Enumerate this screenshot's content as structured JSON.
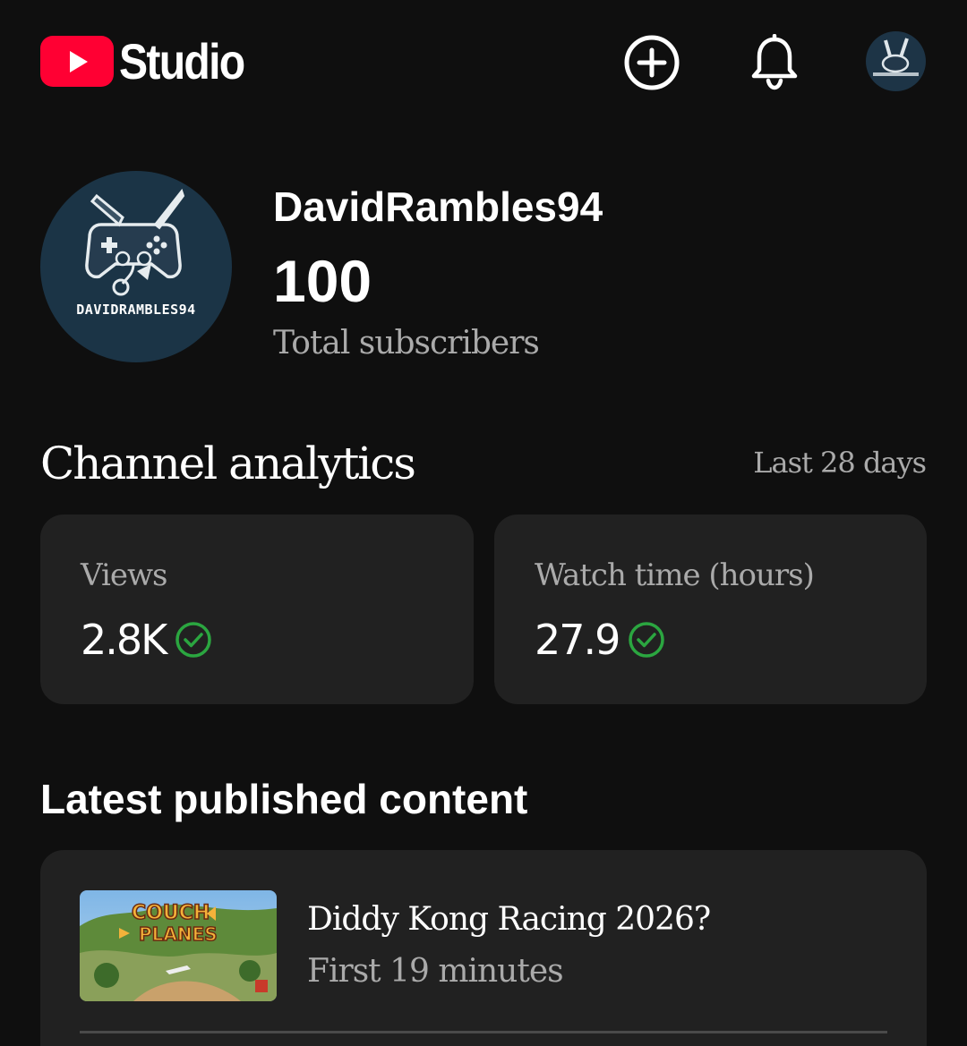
{
  "header": {
    "app_name": "Studio",
    "colors": {
      "brand": "#ff0033",
      "background": "#0f0f0f"
    },
    "icons": [
      "youtube-logo-icon",
      "create-plus-icon",
      "bell-icon",
      "account-avatar"
    ]
  },
  "channel": {
    "name": "DavidRambles94",
    "avatar_text": "DAVIDRAMBLES94",
    "subscriber_count": "100",
    "subscriber_label": "Total subscribers"
  },
  "analytics": {
    "title": "Channel analytics",
    "period": "Last 28 days",
    "cards": [
      {
        "label": "Views",
        "value": "2.8K",
        "status_icon": "check-circle-icon",
        "status_color": "#2ba640"
      },
      {
        "label": "Watch time (hours)",
        "value": "27.9",
        "status_icon": "check-circle-icon",
        "status_color": "#2ba640"
      }
    ]
  },
  "latest": {
    "title": "Latest published content",
    "video": {
      "thumbnail_text_line1": "COUCH",
      "thumbnail_text_line2": "PLANES",
      "title": "Diddy Kong Racing 2026?",
      "meta": "First 19 minutes"
    }
  }
}
